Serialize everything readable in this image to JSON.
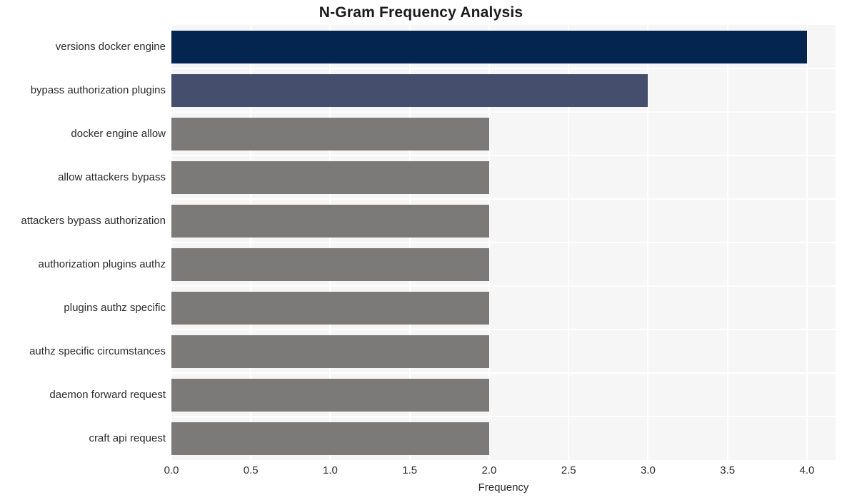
{
  "chart_data": {
    "type": "bar",
    "orientation": "horizontal",
    "title": "N-Gram Frequency Analysis",
    "xlabel": "Frequency",
    "ylabel": "",
    "xlim": [
      0,
      4.18
    ],
    "xticks": [
      "0.0",
      "0.5",
      "1.0",
      "1.5",
      "2.0",
      "2.5",
      "3.0",
      "3.5",
      "4.0"
    ],
    "xtick_values": [
      0.0,
      0.5,
      1.0,
      1.5,
      2.0,
      2.5,
      3.0,
      3.5,
      4.0
    ],
    "grid": true,
    "legend": null,
    "categories": [
      "versions docker engine",
      "bypass authorization plugins",
      "docker engine allow",
      "allow attackers bypass",
      "attackers bypass authorization",
      "authorization plugins authz",
      "plugins authz specific",
      "authz specific circumstances",
      "daemon forward request",
      "craft api request"
    ],
    "values": [
      4,
      3,
      2,
      2,
      2,
      2,
      2,
      2,
      2,
      2
    ],
    "bar_colors": [
      "#042550",
      "#454e6d",
      "#7b7a78",
      "#7b7a78",
      "#7b7a78",
      "#7b7a78",
      "#7b7a78",
      "#7b7a78",
      "#7b7a78",
      "#7b7a78"
    ],
    "plot_background": "#f6f6f7",
    "grid_color": "#ffffff",
    "figure_background": "#ffffff",
    "text_color": "#2b2b2b"
  }
}
